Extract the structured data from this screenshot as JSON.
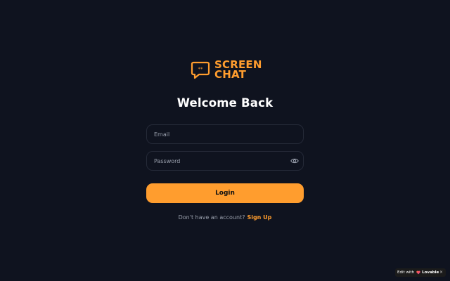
{
  "brand": {
    "line1": "SCREEN",
    "line2": "CHAT",
    "icon": "chat-bubble-icon",
    "color": "#ff9d2e"
  },
  "title": "Welcome Back",
  "form": {
    "email_placeholder": "Email",
    "email_value": "",
    "password_placeholder": "Password",
    "password_value": "",
    "password_toggle_icon": "eye-icon",
    "login_label": "Login"
  },
  "signup": {
    "prompt": "Don't have an account?",
    "link_label": "Sign Up"
  },
  "badge": {
    "prefix": "Edit with",
    "brand": "Lovable",
    "close": "×"
  },
  "colors": {
    "background": "#0f131f",
    "accent": "#ff9d2e",
    "field_border": "#252a38"
  }
}
